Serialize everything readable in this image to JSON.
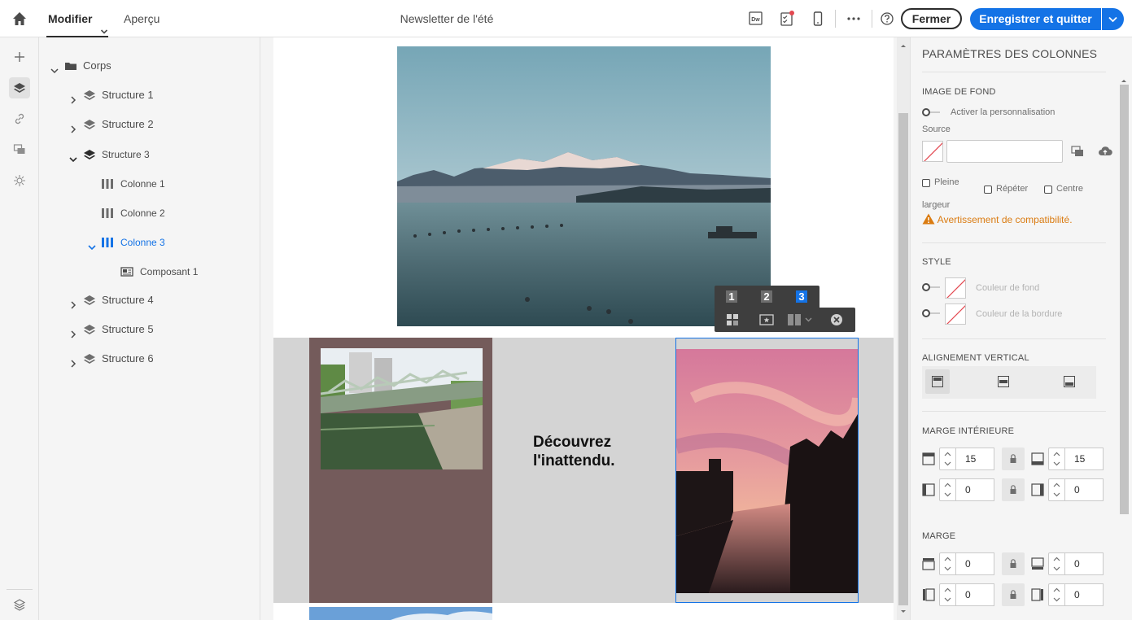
{
  "topbar": {
    "tab_modifier": "Modifier",
    "tab_apercu": "Aperçu",
    "document_title": "Newsletter de l'été",
    "dw_icon_text": "Dw",
    "fermer_label": "Fermer",
    "save_label": "Enregistrer et quitter"
  },
  "tree": {
    "root": "Corps",
    "items": [
      {
        "label": "Structure 1"
      },
      {
        "label": "Structure 2"
      },
      {
        "label": "Structure 3"
      },
      {
        "label": "Colonne 1"
      },
      {
        "label": "Colonne 2"
      },
      {
        "label": "Colonne 3"
      },
      {
        "label": "Composant 1"
      },
      {
        "label": "Structure 4"
      },
      {
        "label": "Structure 5"
      },
      {
        "label": "Structure 6"
      }
    ]
  },
  "canvas": {
    "column2_text": "Découvrez l'inattendu.",
    "column_numbers": [
      "1",
      "2",
      "3"
    ],
    "active_column": "3"
  },
  "panel": {
    "title": "PARAMÈTRES DES COLONNES",
    "background_image": {
      "heading": "IMAGE DE FOND",
      "toggle_label": "Activer la personnalisation",
      "source_label": "Source",
      "source_value": "",
      "option_full": "Pleine",
      "option_repeat": "Répéter",
      "option_center": "Centre",
      "width_label": "largeur",
      "warning": "Avertissement de compatibilité."
    },
    "style": {
      "heading": "STYLE",
      "bg_color_label": "Couleur de fond",
      "border_color_label": "Couleur de la bordure"
    },
    "vertical_alignment": {
      "heading": "ALIGNEMENT VERTICAL"
    },
    "padding": {
      "heading": "MARGE INTÉRIEURE",
      "top": "15",
      "bottom": "15",
      "left": "0",
      "right": "0"
    },
    "margin": {
      "heading": "MARGE",
      "top": "0",
      "bottom": "0",
      "left": "0",
      "right": "0"
    }
  },
  "colors": {
    "accent": "#1473e6",
    "warning": "#da7b11",
    "column1_background": "#745b5b",
    "structure_background": "#d4d4d4"
  }
}
